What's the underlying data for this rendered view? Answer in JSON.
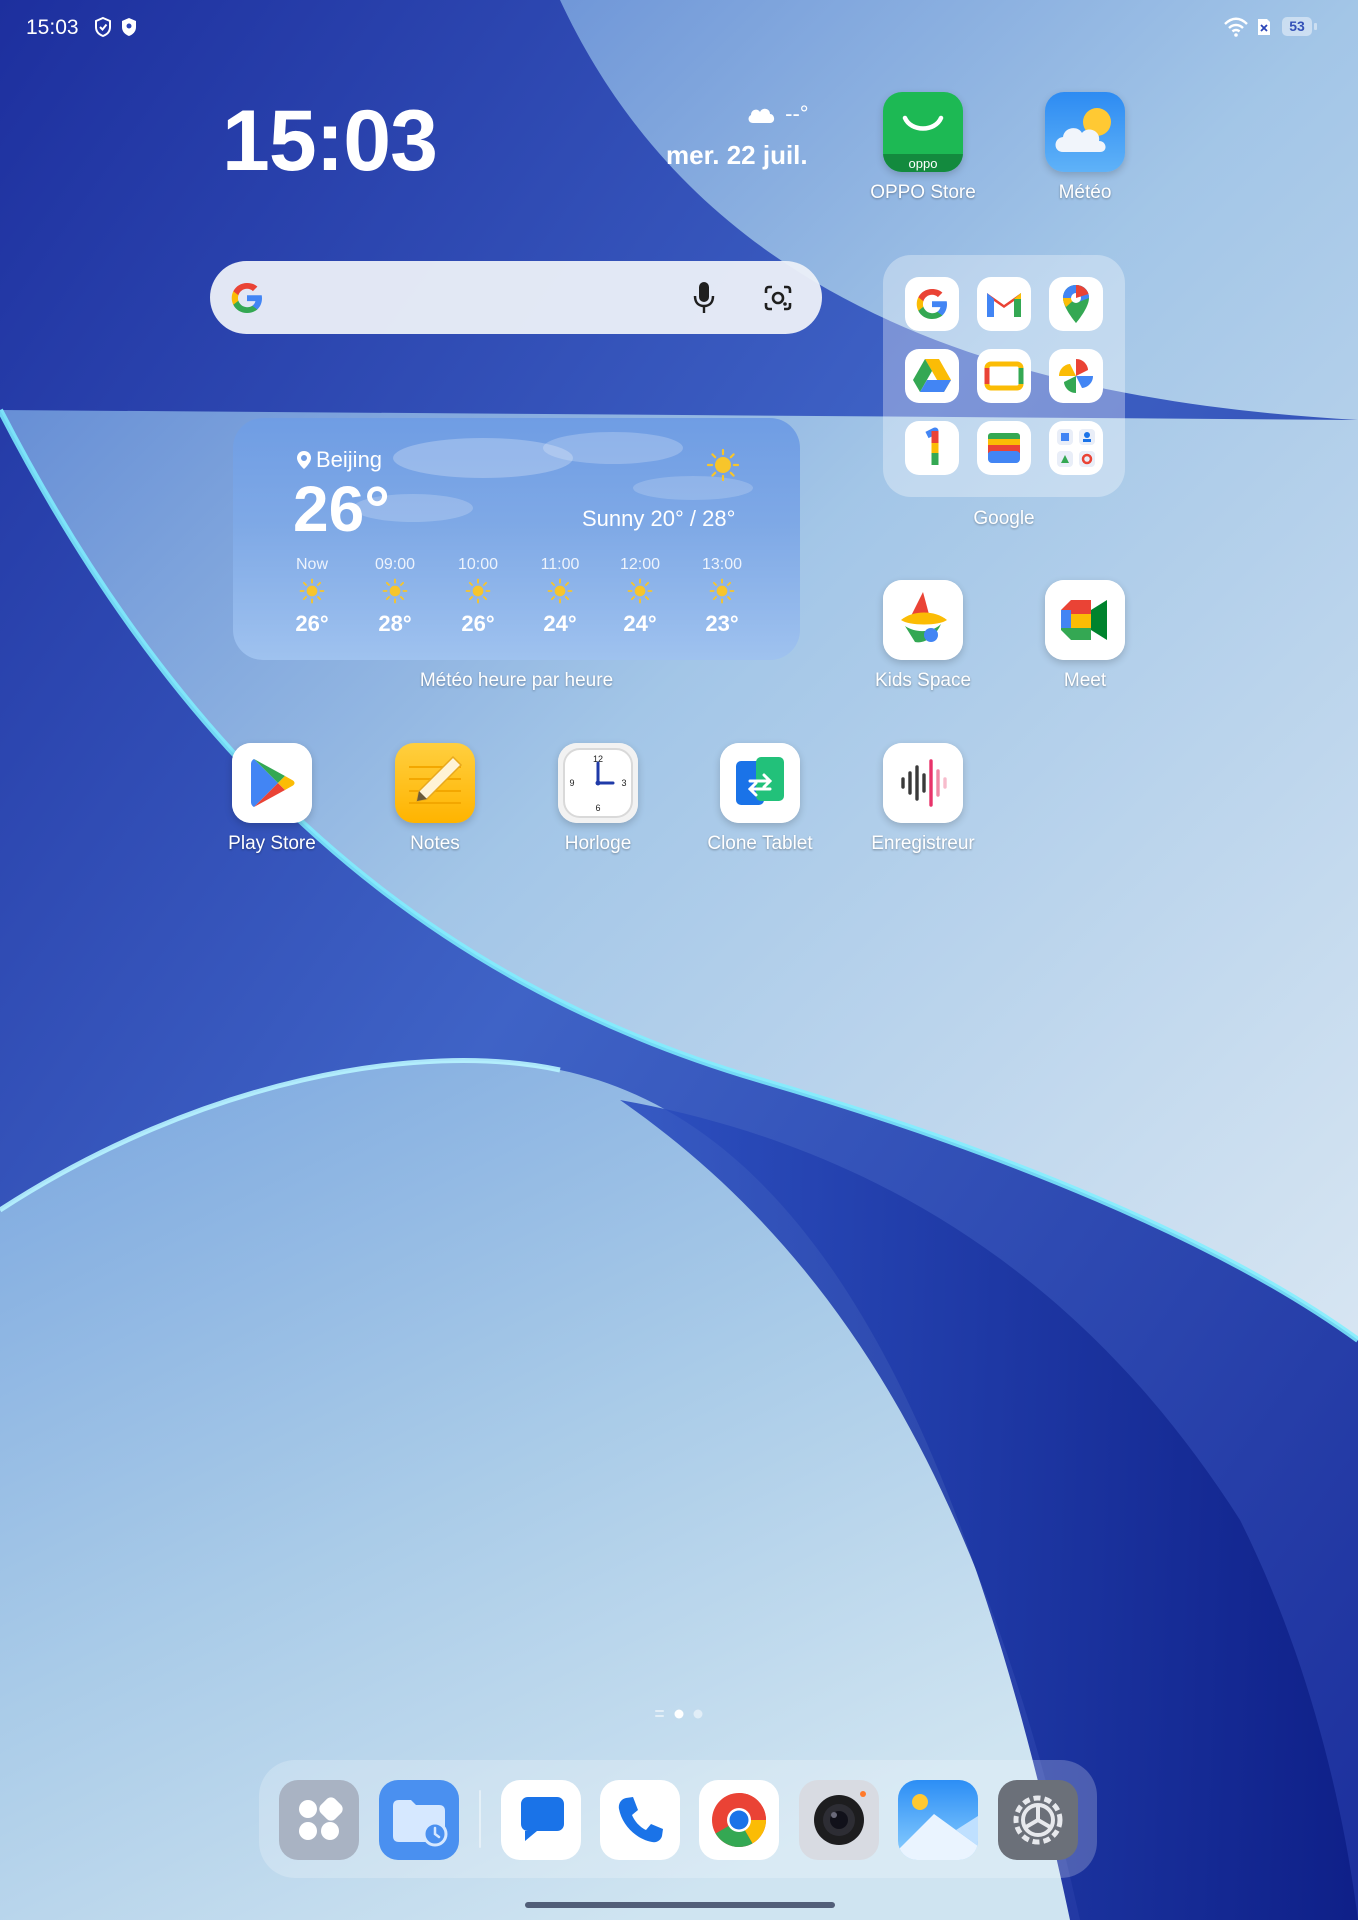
{
  "status_bar": {
    "time": "15:03",
    "left_icons": [
      "shield-outline-icon",
      "shield-filled-icon"
    ],
    "right_icons": [
      "wifi-icon",
      "sim-off-icon",
      "battery-icon"
    ],
    "battery": "53"
  },
  "clock_widget": {
    "time": "15:03",
    "weather_icon": "cloud-icon",
    "weather_temp": "--°",
    "date": "mer. 22 juil."
  },
  "search_bar": {
    "icons": [
      "google-g-icon",
      "microphone-icon",
      "google-lens-icon"
    ]
  },
  "apps": {
    "oppo_store": "OPPO Store",
    "oppo_logo_text": "oppo",
    "meteo": "Météo",
    "kids_space": "Kids Space",
    "meet": "Meet",
    "play_store": "Play Store",
    "notes": "Notes",
    "horloge": "Horloge",
    "clone_tablet": "Clone Tablet",
    "enregistreur": "Enregistreur"
  },
  "folder": {
    "label": "Google",
    "items": [
      "google-icon",
      "gmail-icon",
      "maps-icon",
      "drive-icon",
      "slides-icon",
      "photos-icon",
      "google-one-icon",
      "wallet-icon",
      "more-apps-icon"
    ]
  },
  "weather_widget": {
    "label": "Météo heure par heure",
    "city": "Beijing",
    "temperature": "26°",
    "condition": "Sunny 20° / 28°",
    "condition_icon": "sun-icon",
    "hours": [
      {
        "time": "Now",
        "temp": "26°"
      },
      {
        "time": "09:00",
        "temp": "28°"
      },
      {
        "time": "10:00",
        "temp": "26°"
      },
      {
        "time": "11:00",
        "temp": "24°"
      },
      {
        "time": "12:00",
        "temp": "24°"
      },
      {
        "time": "13:00",
        "temp": "23°"
      }
    ]
  },
  "page_indicator": {
    "pages": 3,
    "active": 2
  },
  "dock": {
    "apps": [
      "app-drawer-icon",
      "files-icon",
      "messages-icon",
      "phone-icon",
      "chrome-icon",
      "camera-icon",
      "photos-gallery-icon",
      "settings-icon"
    ]
  },
  "colors": {
    "accent_blue": "#2a45b8",
    "oppo_green": "#1db954",
    "sun_yellow": "#f7c52b"
  }
}
